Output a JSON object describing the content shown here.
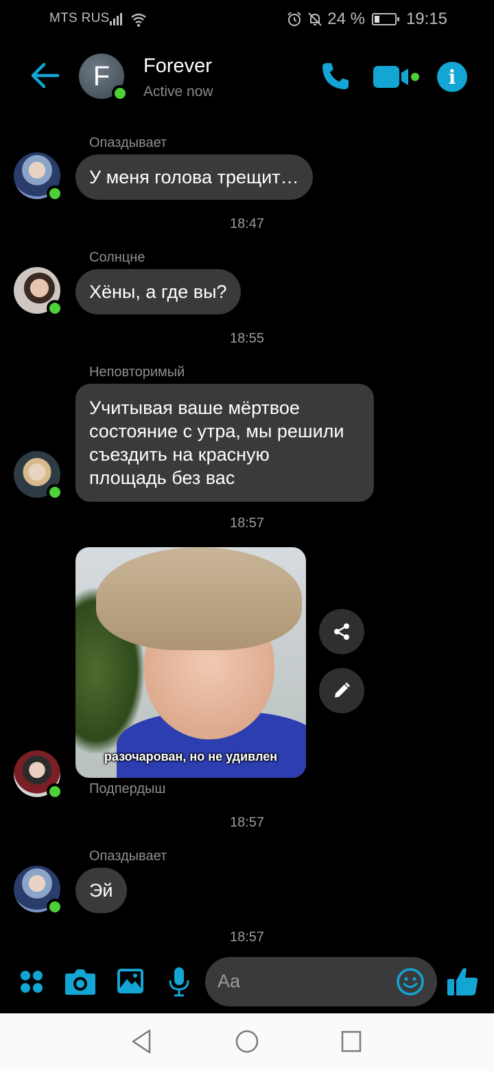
{
  "status_bar": {
    "carrier": "MTS RUS",
    "battery": "24 %",
    "time": "19:15",
    "battery_level": 0.24
  },
  "header": {
    "avatar_letter": "F",
    "name": "Forever",
    "status": "Active now"
  },
  "messages": [
    {
      "sender": "Опаздывает",
      "text": "У меня голова трещит…",
      "time": "18:47"
    },
    {
      "sender": "Солнцне",
      "text": "Хёны, а где вы?",
      "time": "18:55"
    },
    {
      "sender": "Неповторимый",
      "text": "Учитывая ваше мёртвое\nсостояние с утра, мы решили\nсъездить на красную\nплощадь без вас",
      "time": "18:57"
    },
    {
      "sender": "Подпердыш",
      "image_caption": "разочарован, но не удивлен",
      "time": "18:57"
    },
    {
      "sender": "Опаздывает",
      "text": "Эй",
      "time": "18:57"
    }
  ],
  "composer": {
    "placeholder": "Aa"
  },
  "colors": {
    "accent": "#13a6d4",
    "online": "#4cd137",
    "bubble": "#3a3a3c"
  }
}
